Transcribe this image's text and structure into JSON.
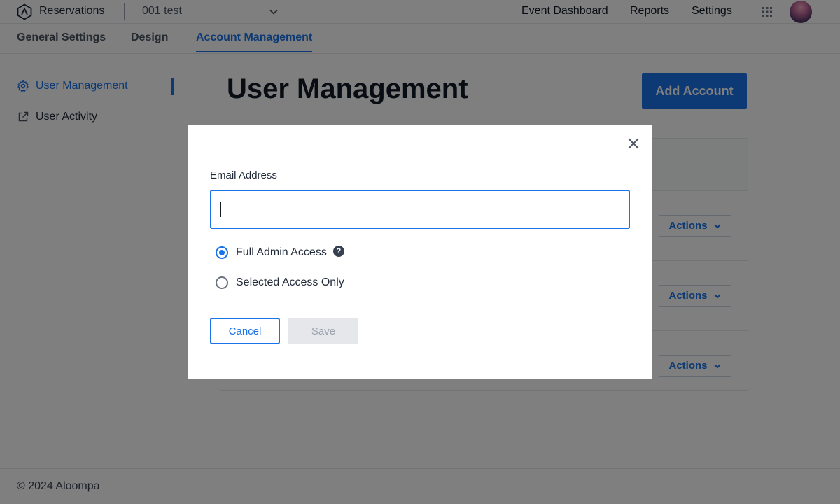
{
  "app": {
    "name": "Reservations",
    "project": "001 test",
    "logo_icon": "aloompa-logo-icon"
  },
  "topnav": {
    "items": [
      {
        "label": "Event Dashboard"
      },
      {
        "label": "Reports"
      },
      {
        "label": "Settings"
      }
    ],
    "apps_icon": "grid-icon"
  },
  "tabs": [
    {
      "label": "General Settings"
    },
    {
      "label": "Design"
    },
    {
      "label": "Account Management",
      "active": true
    }
  ],
  "sidebar": {
    "items": [
      {
        "label": "User Management",
        "icon": "gear-icon",
        "active": true
      },
      {
        "label": "User Activity",
        "icon": "external-link-icon"
      }
    ]
  },
  "main": {
    "title": "User Management",
    "add_button": "Add Account",
    "rows": [
      {
        "actions_label": "Actions"
      },
      {
        "actions_label": "Actions"
      },
      {
        "actions_label": "Actions"
      }
    ]
  },
  "modal": {
    "email_label": "Email Address",
    "email_value": "",
    "options": [
      {
        "label": "Full Admin Access",
        "checked": true,
        "help_icon": "?"
      },
      {
        "label": "Selected Access Only",
        "checked": false
      }
    ],
    "cancel_label": "Cancel",
    "save_label": "Save"
  },
  "footer": {
    "text": "© 2024 Aloompa"
  },
  "colors": {
    "accent": "#1a73e8",
    "overlay": "rgba(0,0,0,0.5)"
  }
}
